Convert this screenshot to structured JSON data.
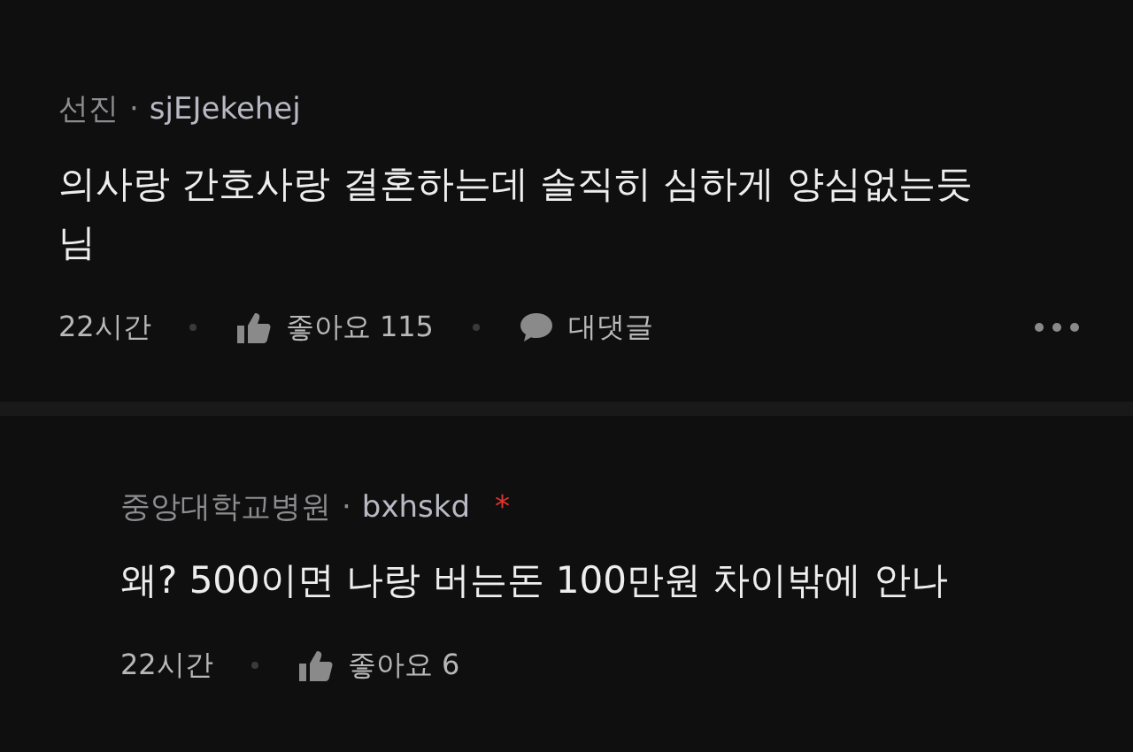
{
  "comments": [
    {
      "kind": "comment",
      "company": "선진",
      "separator": "·",
      "nickname": "sjEJekehej",
      "body": "의사랑 간호사랑 결혼하는데 솔직히 심하게 양심없는듯 님",
      "time": "22시간",
      "like_label": "좋아요 115",
      "reply_label": "대댓글",
      "more": true
    },
    {
      "kind": "reply",
      "company": "중앙대학교병원",
      "separator": "·",
      "nickname": "bxhskd",
      "author_mark": "*",
      "body": "왜? 500이면 나랑 버는돈 100만원 차이밖에 안나",
      "time": "22시간",
      "like_label": "좋아요 6"
    }
  ]
}
